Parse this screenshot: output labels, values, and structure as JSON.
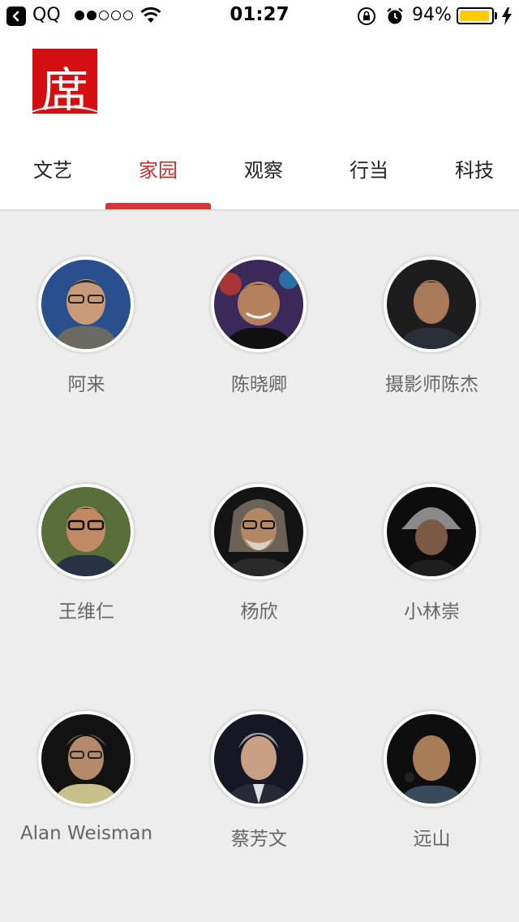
{
  "status_bar": {
    "carrier": "QQ",
    "time": "01:27",
    "battery_percent": "94%",
    "battery_level": 0.94,
    "signal_bars_on": 2,
    "signal_bars_total": 5,
    "battery_color": "#ffcc00"
  },
  "header": {
    "logo_text": "席",
    "logo_color": "#d40f12"
  },
  "tabs": [
    {
      "label": "文艺",
      "active": false
    },
    {
      "label": "家园",
      "active": true
    },
    {
      "label": "观察",
      "active": false
    },
    {
      "label": "行当",
      "active": false
    },
    {
      "label": "科技",
      "active": false
    }
  ],
  "accent_color": "#c9302c",
  "people": [
    {
      "name": "阿来"
    },
    {
      "name": "陈晓卿"
    },
    {
      "name": "摄影师陈杰"
    },
    {
      "name": "王维仁"
    },
    {
      "name": "杨欣"
    },
    {
      "name": "小林崇"
    },
    {
      "name": "Alan Weisman"
    },
    {
      "name": "蔡芳文"
    },
    {
      "name": "远山"
    }
  ]
}
